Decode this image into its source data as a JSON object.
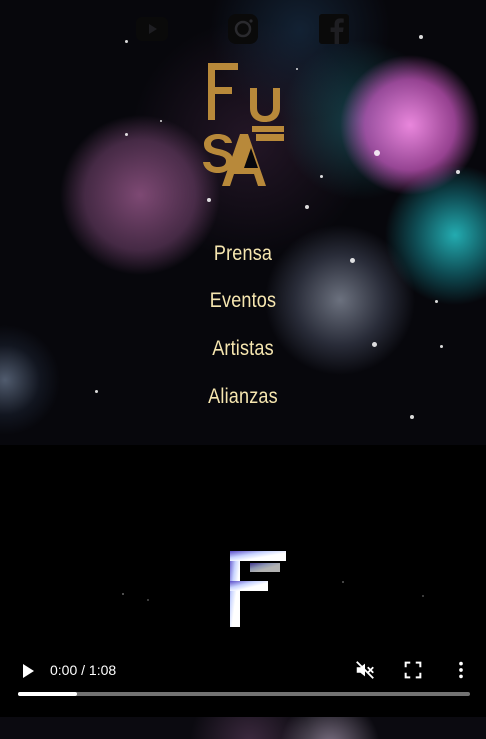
{
  "social": [
    {
      "icon": "youtube-icon"
    },
    {
      "icon": "instagram-icon"
    },
    {
      "icon": "facebook-icon"
    }
  ],
  "logo": {
    "text": "FUSA",
    "color": "#b8893a"
  },
  "nav": {
    "items": [
      {
        "label": "Prensa"
      },
      {
        "label": "Eventos"
      },
      {
        "label": "Artistas"
      },
      {
        "label": "Alianzas"
      }
    ],
    "color": "#f6e6b0"
  },
  "video": {
    "current_time": "0:00",
    "duration": "1:08",
    "time_display": "0:00 / 1:08",
    "progress_fraction": 0.13,
    "muted": true,
    "frame_letter": "F"
  }
}
